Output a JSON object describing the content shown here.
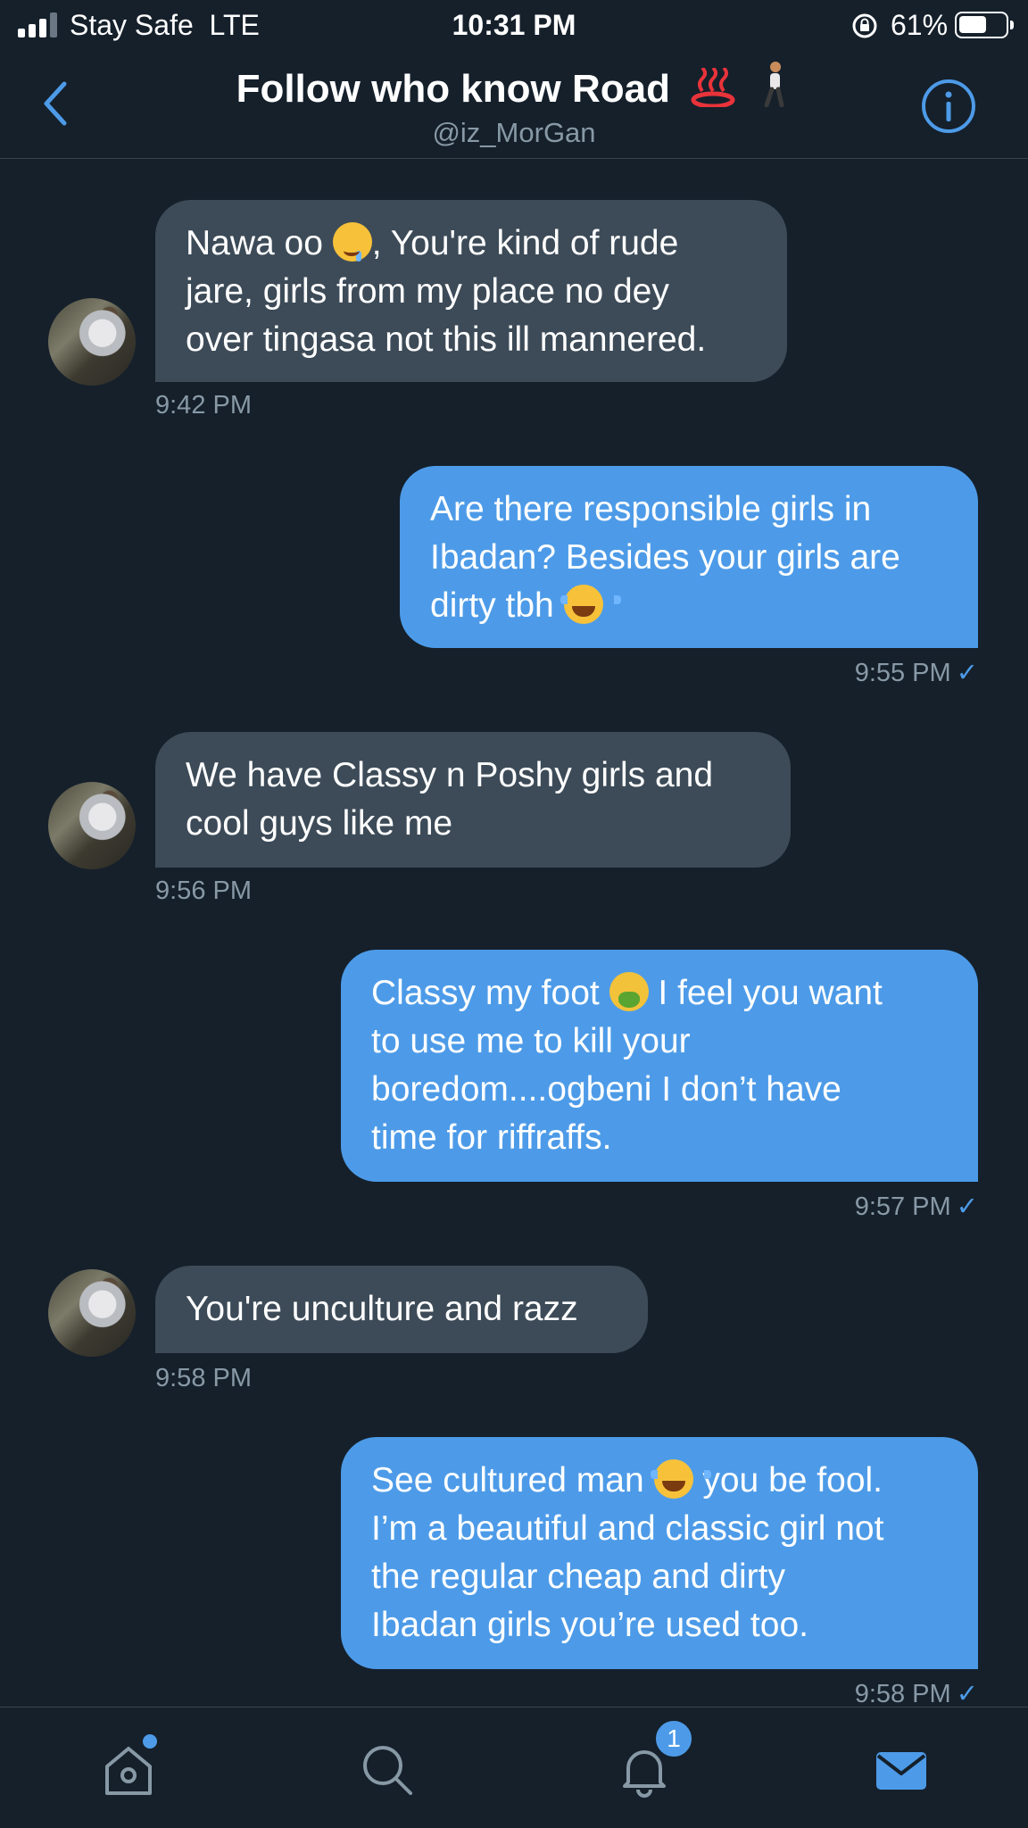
{
  "status_bar": {
    "carrier": "Stay Safe  LTE",
    "time": "10:31 PM",
    "battery": "61%",
    "battery_level": 0.61
  },
  "header": {
    "title": "Follow who know Road",
    "handle": "@iz_MorGan"
  },
  "messages": [
    {
      "direction": "incoming",
      "lines": [
        "Nawa oo",
        ", You're kind of rude",
        "jare, girls from my place no dey",
        "over tingasa not this ill mannered."
      ],
      "time": "9:42 PM"
    },
    {
      "direction": "outgoing",
      "lines": [
        "Are there responsible girls in",
        "Ibadan? Besides your girls are",
        "dirty tbh"
      ],
      "time": "9:55 PM",
      "check": "✓"
    },
    {
      "direction": "incoming",
      "lines": [
        "We have Classy n Poshy girls and",
        "cool guys like me"
      ],
      "time": "9:56 PM"
    },
    {
      "direction": "outgoing",
      "lines": [
        "Classy my foot",
        " I feel you want",
        "to use me to kill your",
        "boredom....ogbeni I don’t have",
        "time for riffraffs."
      ],
      "time": "9:57 PM",
      "check": "✓"
    },
    {
      "direction": "incoming",
      "lines": [
        "You're unculture and razz"
      ],
      "time": "9:58 PM"
    },
    {
      "direction": "outgoing",
      "lines": [
        "See cultured man",
        " you be fool.",
        "I’m a beautiful and classic girl not",
        "the regular cheap and dirty",
        "Ibadan girls you’re used too."
      ],
      "time": "9:58 PM",
      "check": "✓"
    }
  ],
  "tab_bar": {
    "notifications_badge": "1",
    "active_tab": "messages"
  },
  "icons": [
    "back-icon",
    "info-icon",
    "home-icon",
    "search-icon",
    "bell-icon",
    "mail-icon"
  ],
  "colors": {
    "background": "#15202b",
    "incoming_bubble": "#3d4b58",
    "outgoing_bubble": "#4d9be8",
    "accent": "#4d9be8",
    "secondary_text": "#8899a6"
  }
}
